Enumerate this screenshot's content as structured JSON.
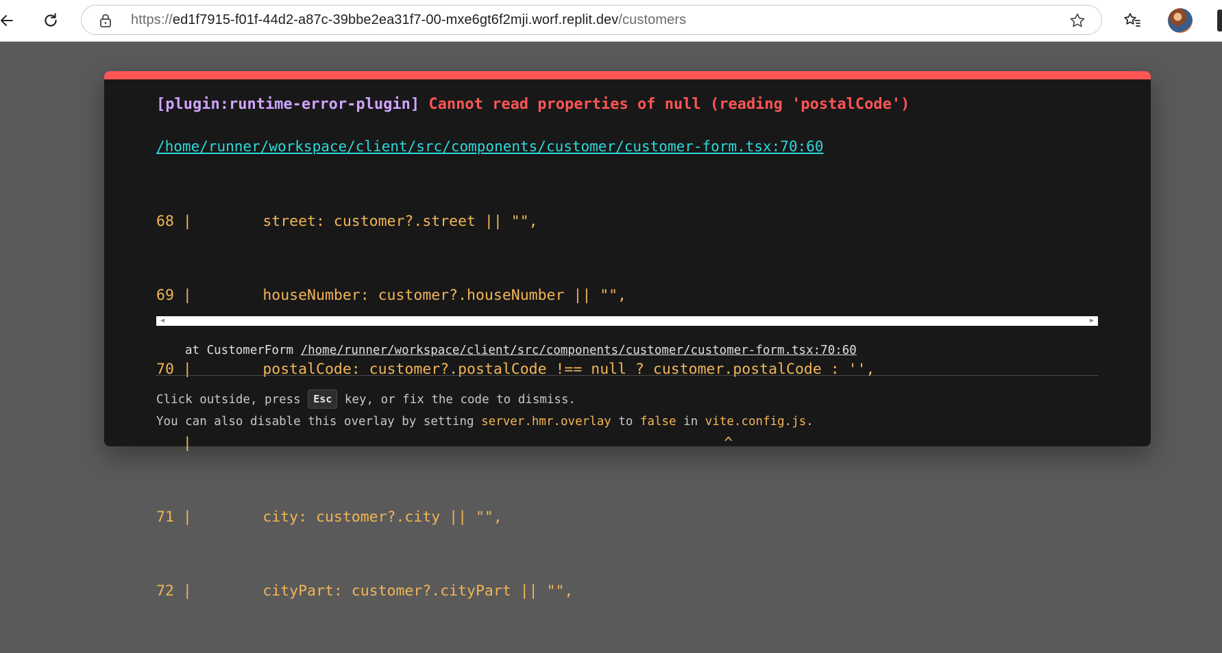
{
  "browser": {
    "url_scheme": "https://",
    "url_host": "ed1f7915-f01f-44d2-a87c-39bbe2ea31f7-00-mxe6gt6f2mji.worf.replit.dev",
    "url_path": "/customers",
    "icons": [
      "back-arrow-icon",
      "reload-icon",
      "lock-icon",
      "star-icon",
      "favorites-icon",
      "avatar"
    ]
  },
  "overlay": {
    "plugin": "[plugin:runtime-error-plugin]",
    "message": "Cannot read properties of null (reading 'postalCode')",
    "file": "/home/runner/workspace/client/src/components/customer/customer-form.tsx:70:60",
    "frame_lines": [
      "68 |        street: customer?.street || \"\",",
      "69 |        houseNumber: customer?.houseNumber || \"\",",
      "70 |        postalCode: customer?.postalCode !== null ? customer.postalCode : '',",
      "   |                                                            ^",
      "71 |        city: customer?.city || \"\",",
      "72 |        cityPart: customer?.cityPart || \"\","
    ],
    "stack_prefix": "at CustomerForm ",
    "stack_path": "/home/runner/workspace/client/src/components/customer/customer-form.tsx:70:60",
    "tip_line1_a": "Click outside, press ",
    "tip_key": "Esc",
    "tip_line1_b": " key, or fix the code to dismiss.",
    "tip_line2_a": "You can also disable this overlay by setting ",
    "tip_code1": "server.hmr.overlay",
    "tip_line2_b": " to ",
    "tip_code2": "false",
    "tip_line2_c": " in ",
    "tip_code3": "vite.config.js",
    "tip_line2_d": ".",
    "colors": {
      "accent_bar": "#ff5555",
      "plugin": "#cfa4ff",
      "message": "#ff5555",
      "link": "#2dd9da",
      "code": "#f3b556",
      "card_bg": "#181818",
      "backdrop": "#5a5a5a"
    }
  }
}
